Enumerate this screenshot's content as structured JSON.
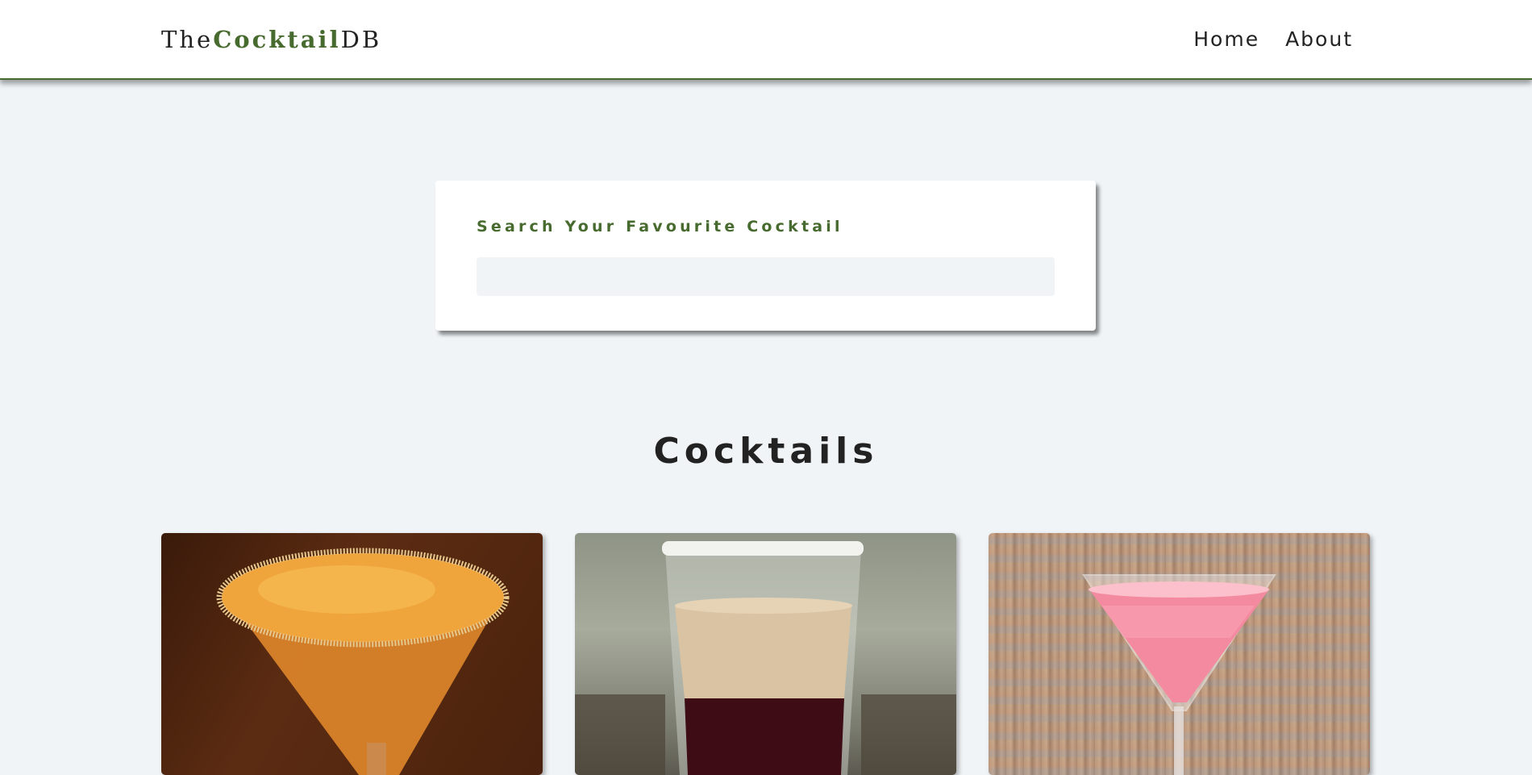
{
  "header": {
    "logo": {
      "prefix": "The",
      "accent": "Cocktail",
      "suffix": "DB"
    },
    "nav": [
      {
        "label": "Home"
      },
      {
        "label": "About"
      }
    ]
  },
  "search": {
    "label": "Search Your Favourite Cocktail",
    "value": "",
    "placeholder": ""
  },
  "cocktails": {
    "title": "Cocktails",
    "items": [
      {
        "image": "orange-martini-with-sugar-rim"
      },
      {
        "image": "layered-shot-glass-cream-over-red"
      },
      {
        "image": "pink-martini"
      }
    ]
  },
  "colors": {
    "accent": "#476a2e",
    "background": "#f0f4f7",
    "text": "#222222",
    "surface": "#ffffff"
  }
}
